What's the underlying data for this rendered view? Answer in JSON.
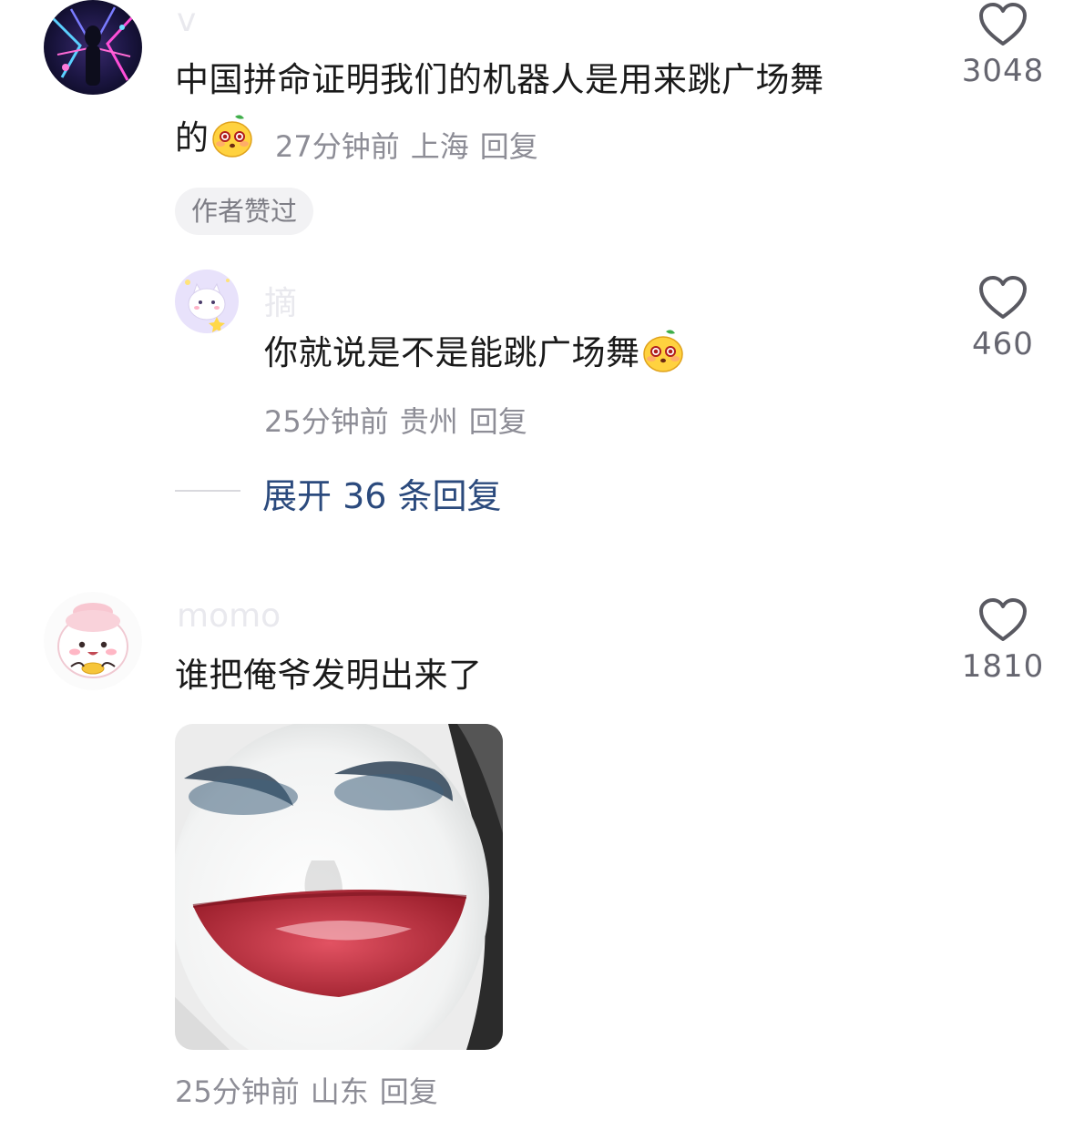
{
  "comments": [
    {
      "username": "v",
      "avatar_icon": "neon-figure-avatar-icon",
      "text": "中国拼命证明我们的机器人是用来跳广场舞",
      "text_tail": "的",
      "emoji": "mango-face-emoji-icon",
      "time": "27分钟前",
      "location": "上海",
      "reply_label": "回复",
      "badge": "作者赞过",
      "like_count": "3048"
    },
    {
      "username": "摘",
      "avatar_icon": "cat-star-avatar-icon",
      "text": "你就说是不是能跳广场舞",
      "emoji": "mango-face-emoji-icon",
      "time": "25分钟前",
      "location": "贵州",
      "reply_label": "回复",
      "like_count": "460"
    },
    {
      "username": "momo",
      "avatar_icon": "peach-bun-avatar-icon",
      "text": "谁把俺爷发明出来了",
      "sticker": "clown-face-sticker-image",
      "time": "25分钟前",
      "location": "山东",
      "reply_label": "回复",
      "like_count": "1810"
    }
  ],
  "expand_replies": {
    "label": "展开 36 条回复"
  },
  "icons": {
    "like": "heart-outline-icon"
  },
  "colors": {
    "text_primary": "#1a1a1a",
    "text_secondary": "#8d8d96",
    "link_blue": "#2b4a7d",
    "badge_bg": "#f2f2f4"
  }
}
